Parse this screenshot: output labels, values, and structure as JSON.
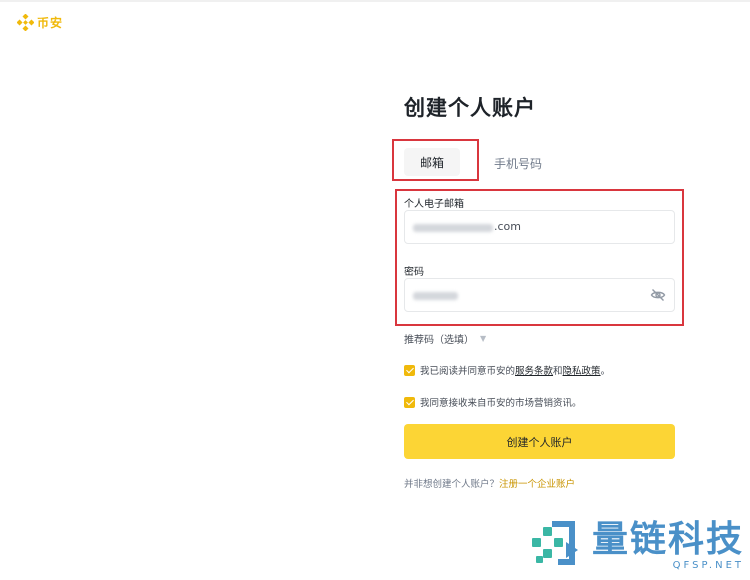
{
  "brand": {
    "logo_icon": "binance-diamond-icon",
    "name": "币安",
    "color": "#f0b90b"
  },
  "page": {
    "title": "创建个人账户"
  },
  "tabs": [
    {
      "label": "邮箱",
      "selected": true
    },
    {
      "label": "手机号码",
      "selected": false
    }
  ],
  "form": {
    "email_label": "个人电子邮箱",
    "email_value_visible": ".com",
    "password_label": "密码",
    "password_toggle_icon": "eye-slash-icon",
    "referral_label": "推荐码（选填）",
    "referral_icon": "caret-down-icon"
  },
  "agreements": {
    "terms_prefix": "我已阅读并同意币安的",
    "terms_link": "服务条款",
    "terms_and": "和",
    "privacy_link": "隐私政策",
    "terms_suffix": "。",
    "terms_checked": true,
    "marketing_text": "我同意接收来自币安的市场营销资讯。",
    "marketing_checked": true
  },
  "submit": {
    "label": "创建个人账户",
    "color": "#fcd535"
  },
  "business": {
    "prefix": "并非想创建个人账户？",
    "link": "注册一个企业账户"
  },
  "watermark": {
    "text": "量链科技",
    "subtext": "QFSP.NET"
  },
  "highlight_color": "#d9363e"
}
